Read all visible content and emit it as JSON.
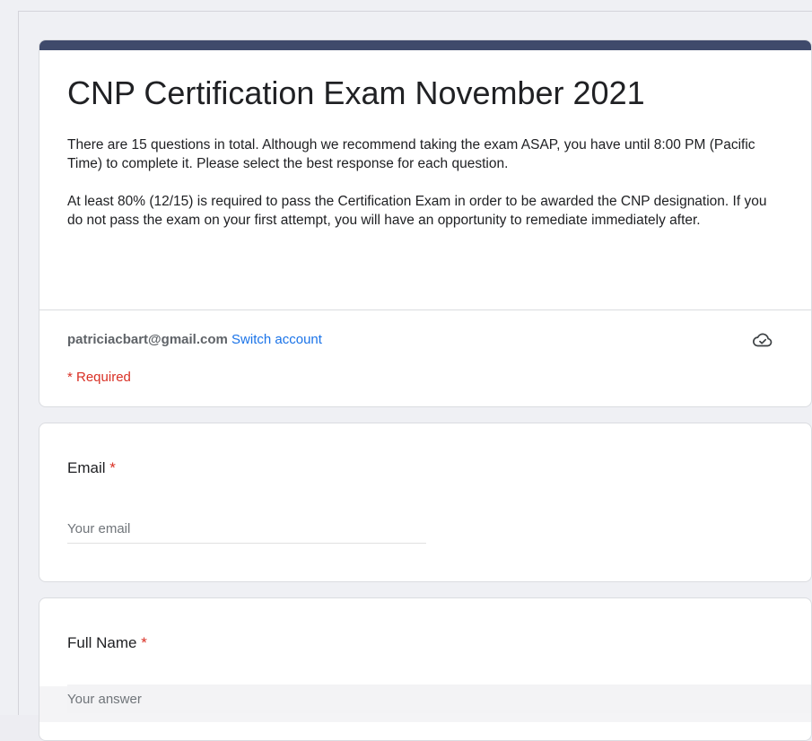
{
  "form": {
    "title": "CNP Certification Exam November 2021",
    "description_1": "There are 15 questions in total. Although we recommend taking the exam ASAP, you have until 8:00 PM (Pacific Time) to complete it. Please select the best response for each question.",
    "description_2": "At least 80% (12/15) is required to pass the Certification Exam in order to be awarded the CNP designation. If you do not pass the exam on your first attempt, you will have an opportunity to remediate immediately after.",
    "accent_color": "#3f4a6b"
  },
  "account": {
    "email": "patriciacbart@gmail.com",
    "switch_label": "Switch account",
    "cloud_icon": "cloud-check-icon",
    "required_note": "* Required"
  },
  "questions": [
    {
      "label": "Email",
      "required_marker": "*",
      "placeholder": "Your email"
    },
    {
      "label": "Full Name",
      "required_marker": "*",
      "placeholder": "Your answer"
    }
  ]
}
